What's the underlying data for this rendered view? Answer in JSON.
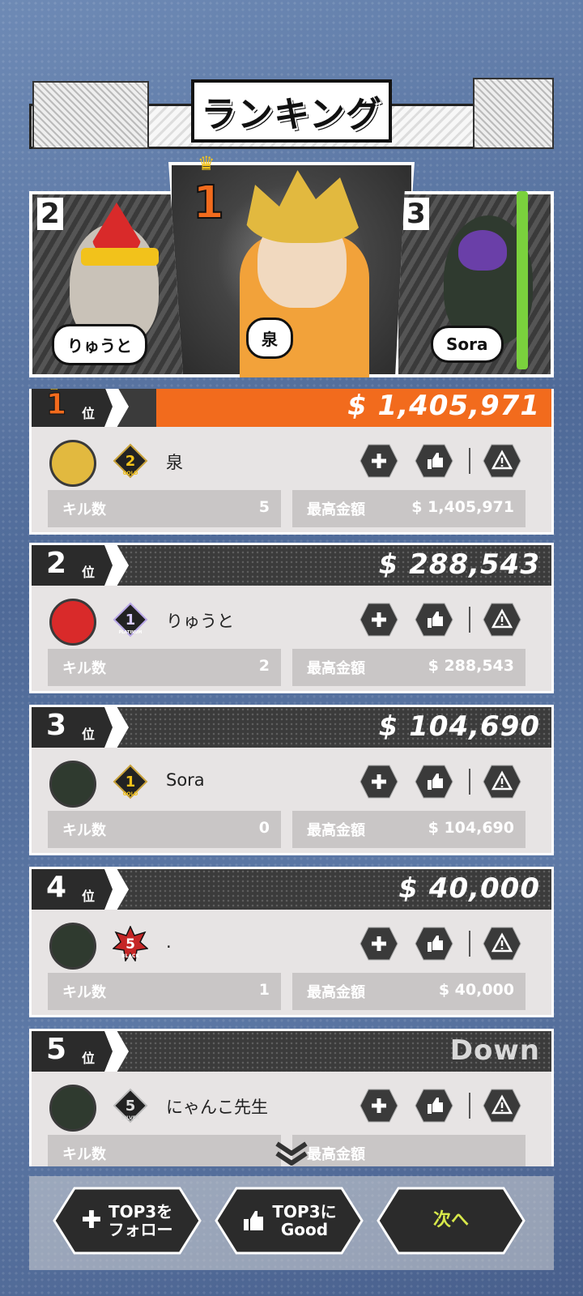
{
  "title": "ランキング",
  "podium": [
    {
      "rank": "2",
      "name": "りゅうと",
      "hair": "#d92a2a"
    },
    {
      "rank": "1",
      "name": "泉",
      "hair": "#e2b93f"
    },
    {
      "rank": "3",
      "name": "Sora",
      "hair": "#6a3fa8"
    }
  ],
  "rank_suffix": "位",
  "stat_labels": {
    "kills": "キル数",
    "max": "最高金額"
  },
  "rankings": [
    {
      "rank": "1",
      "score": "$ 1,405,971",
      "name": "泉",
      "tier_num": "2",
      "tier": "GOLD",
      "kills": "5",
      "max": "$ 1,405,971"
    },
    {
      "rank": "2",
      "score": "$ 288,543",
      "name": "りゅうと",
      "tier_num": "1",
      "tier": "PLATINUM",
      "kills": "2",
      "max": "$ 288,543"
    },
    {
      "rank": "3",
      "score": "$ 104,690",
      "name": "Sora",
      "tier_num": "1",
      "tier": "GOLD",
      "kills": "0",
      "max": "$ 104,690"
    },
    {
      "rank": "4",
      "score": "$ 40,000",
      "name": ".",
      "tier_num": "5",
      "tier": "BLACK",
      "kills": "1",
      "max": "$ 40,000"
    },
    {
      "rank": "5",
      "score": "Down",
      "name": "にゃんこ先生",
      "tier_num": "5",
      "tier": "SILVER",
      "kills": "",
      "max": ""
    }
  ],
  "icons": {
    "follow": "plus-icon",
    "like": "thumbs-up-icon",
    "report": "warning-icon"
  },
  "buttons": {
    "follow_line1": "TOP3を",
    "follow_line2": "フォロー",
    "good_line1": "TOP3に",
    "good_line2": "Good",
    "next": "次へ"
  },
  "colors": {
    "accent": "#f26b1d",
    "gold": "#f2c21b",
    "next_text": "#d7e84a"
  }
}
